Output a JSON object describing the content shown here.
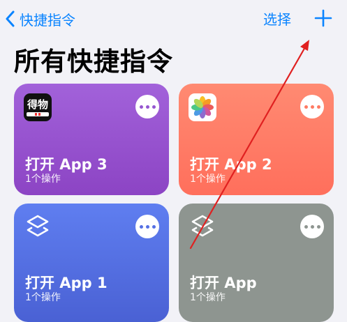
{
  "nav": {
    "back_label": "快捷指令",
    "select_label": "选择"
  },
  "page": {
    "title": "所有快捷指令"
  },
  "shortcuts": [
    {
      "title": "打开 App 3",
      "subtitle": "1个操作",
      "icon": "dedao-app-icon",
      "color": "#9a55d2"
    },
    {
      "title": "打开 App 2",
      "subtitle": "1个操作",
      "icon": "photos-app-icon",
      "color": "#ff7a63"
    },
    {
      "title": "打开 App 1",
      "subtitle": "1个操作",
      "icon": "shortcuts-icon",
      "color": "#5570e4"
    },
    {
      "title": "打开 App",
      "subtitle": "1个操作",
      "icon": "shortcuts-icon",
      "color": "#8e9590"
    }
  ],
  "dedao": {
    "icon_text": "得物"
  },
  "colors": {
    "accent": "#0a84ff",
    "annotation": "#e02020"
  }
}
